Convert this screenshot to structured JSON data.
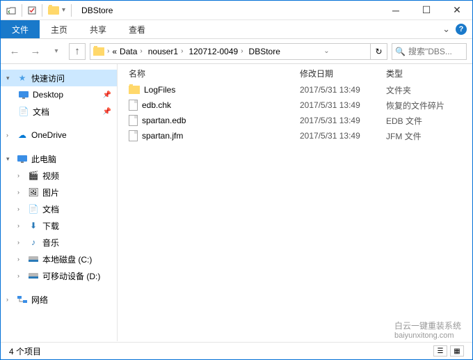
{
  "title": "DBStore",
  "ribbon": {
    "file": "文件",
    "home": "主页",
    "share": "共享",
    "view": "查看"
  },
  "breadcrumbs": [
    "Data",
    "nouser1",
    "120712-0049",
    "DBStore"
  ],
  "search_placeholder": "搜索\"DBS...",
  "columns": {
    "name": "名称",
    "modified": "修改日期",
    "type": "类型"
  },
  "files": [
    {
      "name": "LogFiles",
      "modified": "2017/5/31 13:49",
      "type": "文件夹",
      "icon": "folder"
    },
    {
      "name": "edb.chk",
      "modified": "2017/5/31 13:49",
      "type": "恢复的文件碎片",
      "icon": "file"
    },
    {
      "name": "spartan.edb",
      "modified": "2017/5/31 13:49",
      "type": "EDB 文件",
      "icon": "file"
    },
    {
      "name": "spartan.jfm",
      "modified": "2017/5/31 13:49",
      "type": "JFM 文件",
      "icon": "file"
    }
  ],
  "sidebar": {
    "quick": "快速访问",
    "desktop": "Desktop",
    "documents": "文档",
    "onedrive": "OneDrive",
    "thispc": "此电脑",
    "videos": "视频",
    "pictures": "图片",
    "docs2": "文档",
    "downloads": "下载",
    "music": "音乐",
    "cdrive": "本地磁盘 (C:)",
    "ddrive": "可移动设备 (D:)",
    "network": "网络"
  },
  "status": "4 个项目",
  "watermark": "白云一键重装系统",
  "watermark_url": "baiyunxitong.com"
}
